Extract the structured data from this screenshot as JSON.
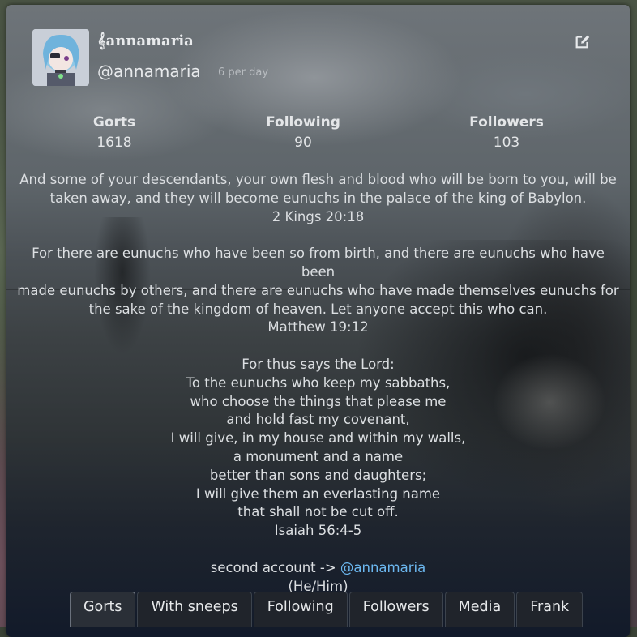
{
  "profile": {
    "display_name": "𝄞annamaria",
    "username": "@annamaria",
    "rate": "6 per day"
  },
  "stats": [
    {
      "label": "Gorts",
      "value": "1618"
    },
    {
      "label": "Following",
      "value": "90"
    },
    {
      "label": "Followers",
      "value": "103"
    }
  ],
  "bio": {
    "p1": [
      "And some of your descendants, your own flesh and blood who will be born to you, will be",
      "taken away, and they will become eunuchs in the palace of the king of Babylon.",
      "2 Kings 20:18"
    ],
    "p2": [
      "For there are eunuchs who have been so from birth, and there are eunuchs who have been",
      "made eunuchs by others, and there are eunuchs who have made themselves eunuchs for",
      "the sake of the kingdom of heaven. Let anyone accept this who can.",
      "Matthew 19:12"
    ],
    "p3": [
      "For thus says the Lord:",
      "To the eunuchs who keep my sabbaths,",
      "who choose the things that please me",
      "and hold fast my covenant,",
      "I will give, in my house and within my walls,",
      "a monument and a name",
      "better than sons and daughters;",
      "I will give them an everlasting name",
      "that shall not be cut off.",
      "Isaiah 56:4-5"
    ],
    "second_account_prefix": "second account -> ",
    "second_account_link": "@annamaria",
    "pronouns": "(He/Him)"
  },
  "tabs": [
    "Gorts",
    "With sneeps",
    "Following",
    "Followers",
    "Media",
    "Frank"
  ],
  "active_tab": "Gorts",
  "colors": {
    "link": "#6cb8f0",
    "text": "#dcdfe2"
  },
  "icons": {
    "edit": "edit-icon"
  }
}
